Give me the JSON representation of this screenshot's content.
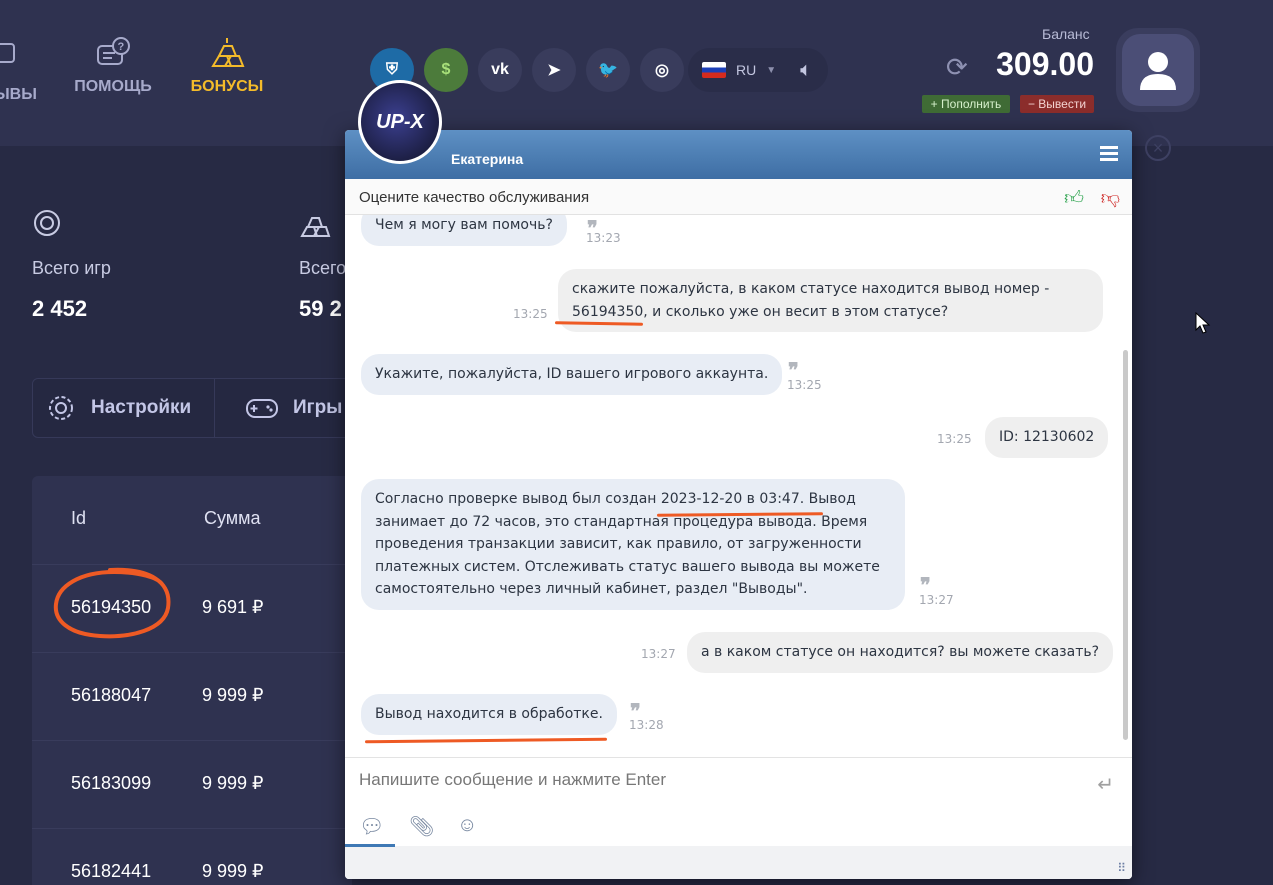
{
  "nav": {
    "reviews_label": "ЫВЫ",
    "help_label": "ПОМОЩЬ",
    "bonuses_label": "БОНУСЫ"
  },
  "socials": [
    {
      "name": "rank-icon",
      "glyph": "⛨"
    },
    {
      "name": "dollar-icon",
      "glyph": "$"
    },
    {
      "name": "vk-icon",
      "glyph": "vk"
    },
    {
      "name": "telegram-icon",
      "glyph": "➤"
    },
    {
      "name": "twitter-icon",
      "glyph": "🐦"
    },
    {
      "name": "instagram-icon",
      "glyph": "◎"
    }
  ],
  "language": {
    "code": "RU"
  },
  "balance": {
    "label": "Баланс",
    "value": "309.00",
    "deposit_label": "Пополнить",
    "withdraw_label": "Вывести"
  },
  "stats": {
    "games_label": "Всего игр",
    "games_value": "2 452",
    "second_label": "Всего",
    "second_value": "59 2"
  },
  "tabs": {
    "settings_label": "Настройки",
    "games_label": "Игры"
  },
  "table": {
    "headers": {
      "id": "Id",
      "sum": "Сумма"
    },
    "rows": [
      {
        "id": "56194350",
        "sum": "9 691 ₽"
      },
      {
        "id": "56188047",
        "sum": "9 999 ₽"
      },
      {
        "id": "56183099",
        "sum": "9 999 ₽"
      },
      {
        "id": "56182441",
        "sum": "9 999 ₽"
      }
    ]
  },
  "chat": {
    "logo_text": "UP-X",
    "agent_name": "Екатерина",
    "rate_prompt": "Оцените качество обслуживания",
    "messages": [
      {
        "text": "Чем я могу вам помочь?",
        "time": "13:23",
        "dir": "in"
      },
      {
        "text": "скажите пожалуйста, в каком статусе находится вывод номер -\n56194350, и сколько уже он весит в этом статусе?",
        "time": "13:25",
        "dir": "out"
      },
      {
        "text": "Укажите, пожалуйста, ID вашего игрового аккаунта.",
        "time": "13:25",
        "dir": "in"
      },
      {
        "text": "ID: 12130602",
        "time": "13:25",
        "dir": "out"
      },
      {
        "text": "Согласно проверке вывод был создан 2023-12-20 в 03:47. Вывод\nзанимает до 72 часов, это стандартная процедура вывода. Время\nпроведения транзакции зависит, как правило, от загруженности\nплатежных систем. Отслеживать статус вашего вывода вы можете\nсамостоятельно через личный кабинет, раздел \"Выводы\".",
        "time": "13:27",
        "dir": "in"
      },
      {
        "text": "а в каком статусе он находится? вы можете сказать?",
        "time": "13:27",
        "dir": "out"
      },
      {
        "text": "Вывод находится в обработке.",
        "time": "13:28",
        "dir": "in"
      }
    ],
    "input_placeholder": "Напишите сообщение и нажмите Enter"
  },
  "colors": {
    "background": "#272a44",
    "accent_gold": "#f4bb2a",
    "chat_header": "#4a7cb3",
    "annotation": "#ee5a24"
  }
}
